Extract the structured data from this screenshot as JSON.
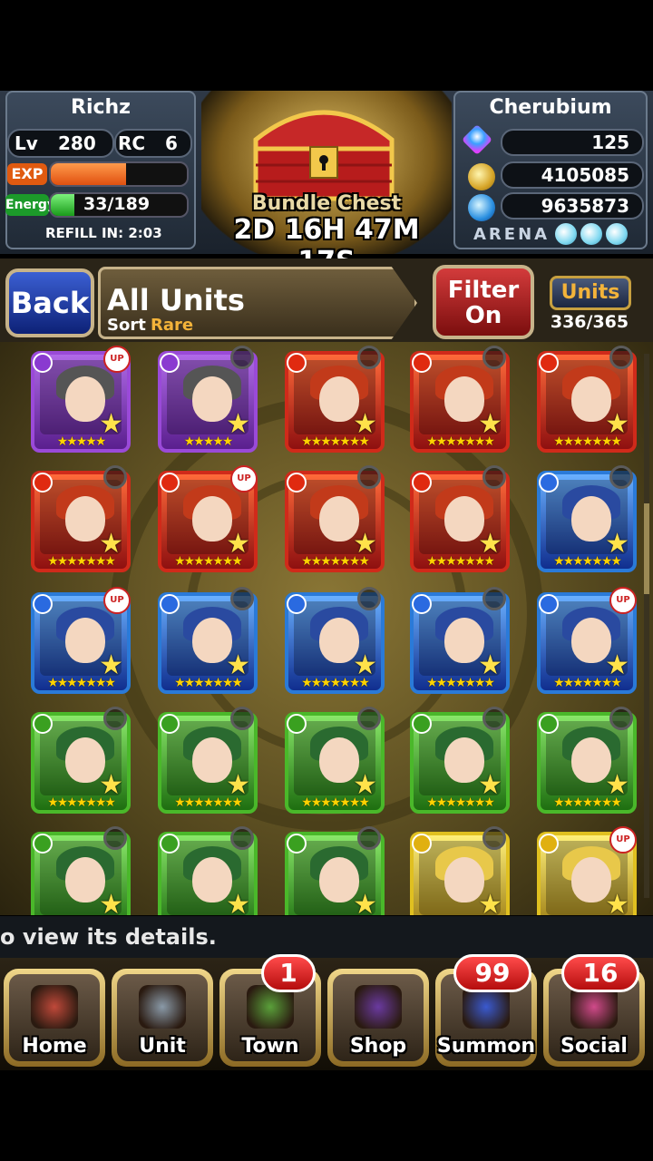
{
  "player": {
    "name": "Richz",
    "lv_label": "Lv",
    "level": "280",
    "rc_label": "RC",
    "rc": "6",
    "exp_label": "EXP",
    "exp_fill": 0.55,
    "energy_label": "Energy",
    "energy": "33/189",
    "energy_fill": 0.17,
    "refill": "REFILL IN: 2:03"
  },
  "friend": {
    "name": "Cherubium",
    "gems": "125",
    "zel": "4105085",
    "karma": "9635873",
    "arena_label": "ARENA"
  },
  "chest": {
    "title": "Bundle Chest",
    "timer": "2D 16H 47M 17S"
  },
  "nav": {
    "back": "Back",
    "title": "All Units",
    "sort_label": "Sort",
    "sort_value": "Rare",
    "filter_line1": "Filter",
    "filter_line2": "On",
    "units_button": "Units",
    "units_count": "336/365"
  },
  "units": [
    {
      "color": "purple",
      "rarity": "★★★★★",
      "up": true
    },
    {
      "color": "purple",
      "rarity": "★★★★★",
      "up": false
    },
    {
      "color": "red",
      "rarity": "★★★★★★★",
      "up": false
    },
    {
      "color": "red",
      "rarity": "★★★★★★★",
      "up": false
    },
    {
      "color": "red",
      "rarity": "★★★★★★★",
      "up": false
    },
    {
      "color": "red",
      "rarity": "★★★★★★★",
      "up": false
    },
    {
      "color": "red",
      "rarity": "★★★★★★★",
      "up": true
    },
    {
      "color": "red",
      "rarity": "★★★★★★★",
      "up": false
    },
    {
      "color": "red",
      "rarity": "★★★★★★★",
      "up": false
    },
    {
      "color": "blue",
      "rarity": "★★★★★★★",
      "up": false
    },
    {
      "color": "blue",
      "rarity": "★★★★★★★",
      "up": true
    },
    {
      "color": "blue",
      "rarity": "★★★★★★★",
      "up": false
    },
    {
      "color": "blue",
      "rarity": "★★★★★★★",
      "up": false
    },
    {
      "color": "blue",
      "rarity": "★★★★★★★",
      "up": false
    },
    {
      "color": "blue",
      "rarity": "★★★★★★★",
      "up": true
    },
    {
      "color": "green",
      "rarity": "★★★★★★★",
      "up": false
    },
    {
      "color": "green",
      "rarity": "★★★★★★★",
      "up": false
    },
    {
      "color": "green",
      "rarity": "★★★★★★★",
      "up": false
    },
    {
      "color": "green",
      "rarity": "★★★★★★★",
      "up": false
    },
    {
      "color": "green",
      "rarity": "★★★★★★★",
      "up": false
    },
    {
      "color": "green",
      "rarity": "★★★★★★★",
      "up": false
    },
    {
      "color": "green",
      "rarity": "★★★★★★★",
      "up": false
    },
    {
      "color": "green",
      "rarity": "★★★★★★★",
      "up": false
    },
    {
      "color": "yellow",
      "rarity": "★★★★★★★",
      "up": false
    },
    {
      "color": "yellow",
      "rarity": "★★★★★★★",
      "up": true
    }
  ],
  "message": "o view its details.",
  "menu": [
    {
      "label": "Home",
      "icon": "home-icon"
    },
    {
      "label": "Unit",
      "icon": "unit-icon"
    },
    {
      "label": "Town",
      "icon": "town-icon",
      "badge": "1"
    },
    {
      "label": "Shop",
      "icon": "shop-icon"
    },
    {
      "label": "Summon",
      "icon": "summon-icon",
      "badge": "99"
    },
    {
      "label": "Social",
      "icon": "social-icon",
      "badge": "16"
    }
  ]
}
